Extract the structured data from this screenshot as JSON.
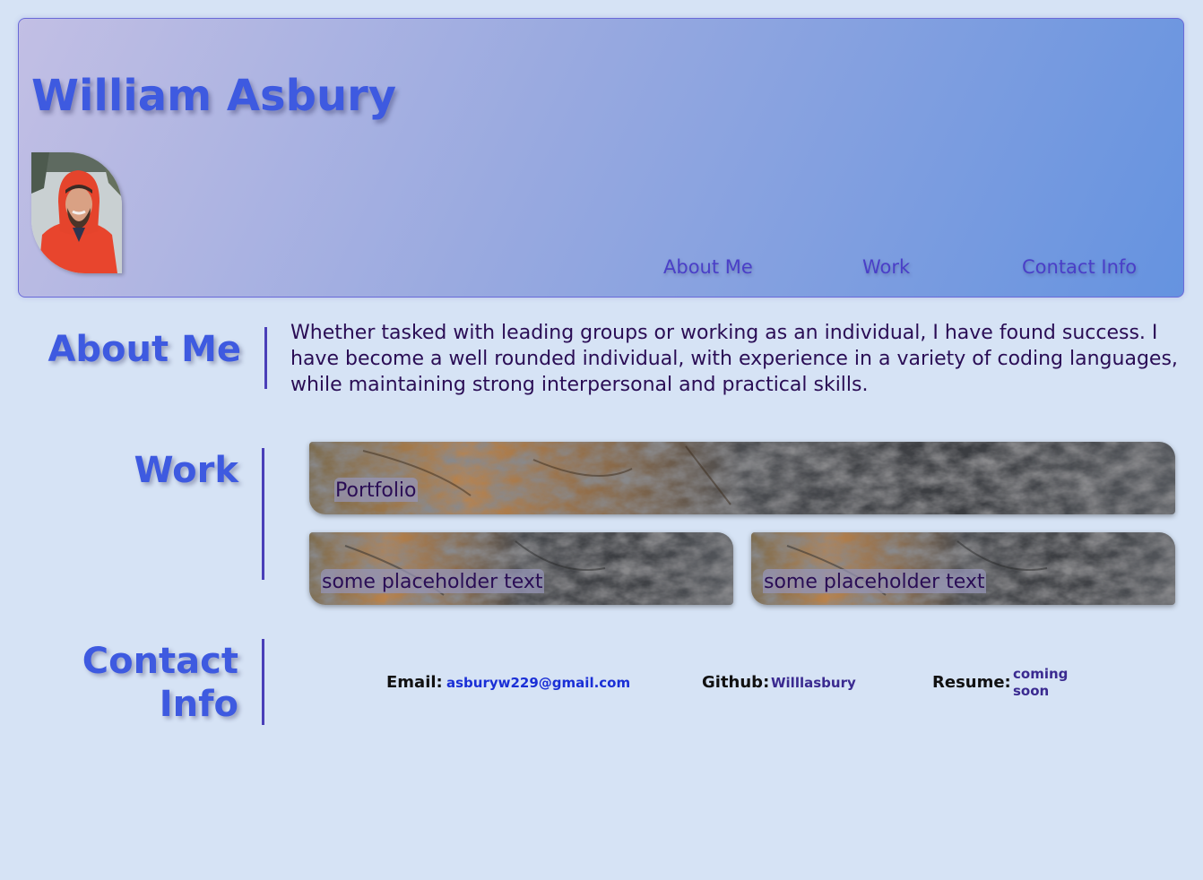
{
  "header": {
    "title": "William Asbury",
    "avatar_icon": "profile-photo",
    "nav": [
      {
        "label": "About Me"
      },
      {
        "label": "Work"
      },
      {
        "label": "Contact Info"
      }
    ]
  },
  "about": {
    "heading": "About Me",
    "text": "Whether tasked with leading groups or working as an individual, I have found success. I have become a well rounded individual, with experience in a variety of coding languages, while maintaining strong interpersonal and practical skills."
  },
  "work": {
    "heading": "Work",
    "cards": [
      {
        "label": "Portfolio"
      },
      {
        "label": "some placeholder text"
      },
      {
        "label": "some placeholder text"
      }
    ]
  },
  "contact": {
    "heading_line1": "Contact",
    "heading_line2": "Info",
    "email_label": "Email:",
    "email_value": "asburyw229@gmail.com",
    "github_label": "Github:",
    "github_value": "Willlasbury",
    "resume_label": "Resume:",
    "resume_value_line1": "coming",
    "resume_value_line2": "soon"
  },
  "colors": {
    "background": "#d6e3f5",
    "accent": "#3e5ae0",
    "nav_text": "#4a3fc8",
    "body_text": "#2a0d55",
    "email_link": "#1a2fd6",
    "link": "#3a2a90"
  }
}
